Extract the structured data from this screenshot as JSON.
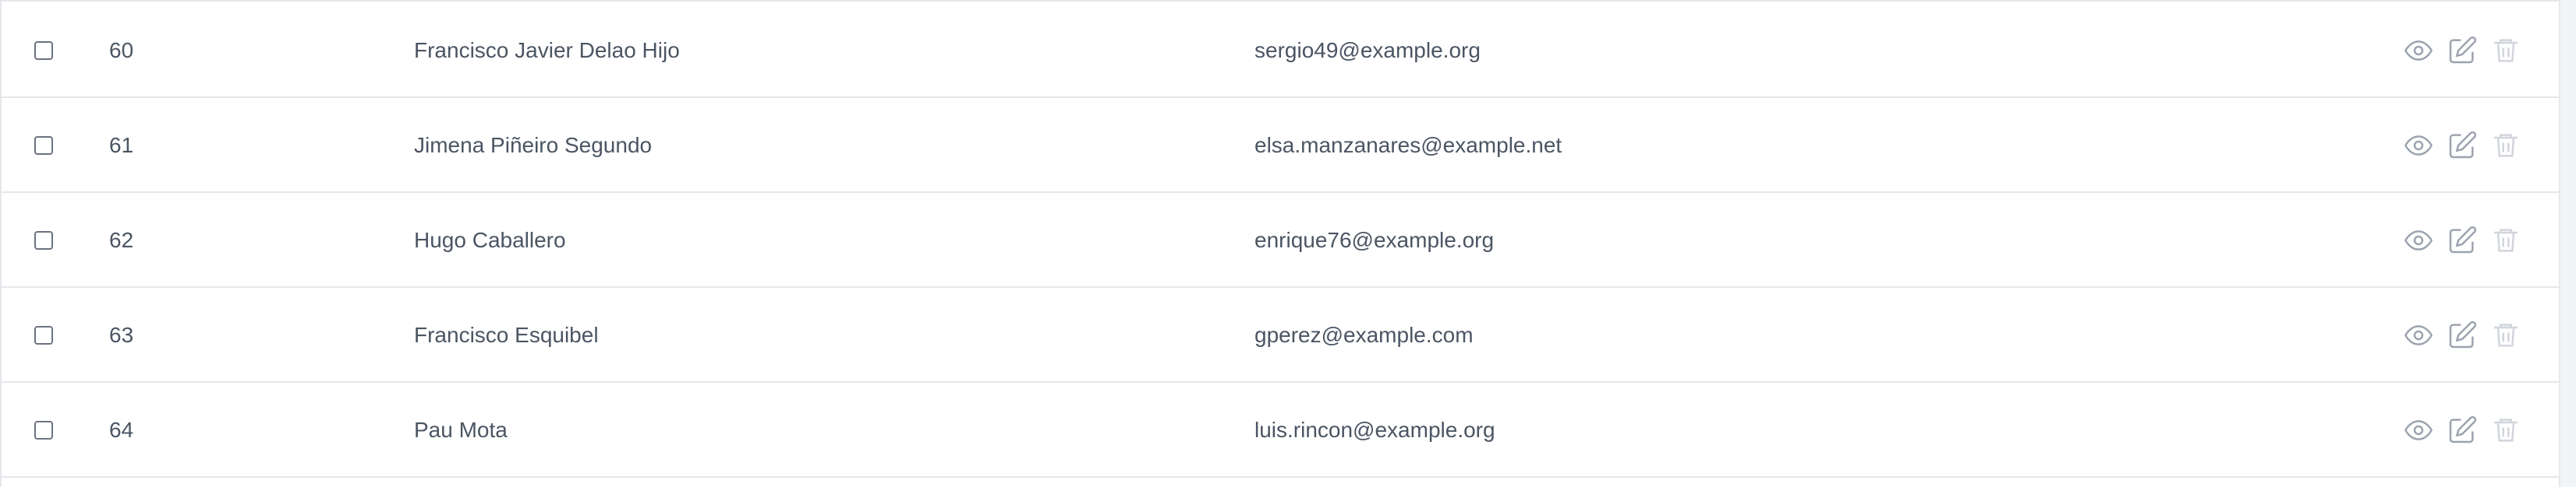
{
  "rows": [
    {
      "id": "60",
      "name": "Francisco Javier Delao Hijo",
      "email": "sergio49@example.org"
    },
    {
      "id": "61",
      "name": "Jimena Piñeiro Segundo",
      "email": "elsa.manzanares@example.net"
    },
    {
      "id": "62",
      "name": "Hugo Caballero",
      "email": "enrique76@example.org"
    },
    {
      "id": "63",
      "name": "Francisco Esquibel",
      "email": "gperez@example.com"
    },
    {
      "id": "64",
      "name": "Pau Mota",
      "email": "luis.rincon@example.org"
    }
  ],
  "icons": {
    "view": "eye-icon",
    "edit": "edit-icon",
    "delete": "trash-icon"
  },
  "colors": {
    "icon": "#9ca3af",
    "text": "#4b5563",
    "border": "#e5e7eb"
  }
}
